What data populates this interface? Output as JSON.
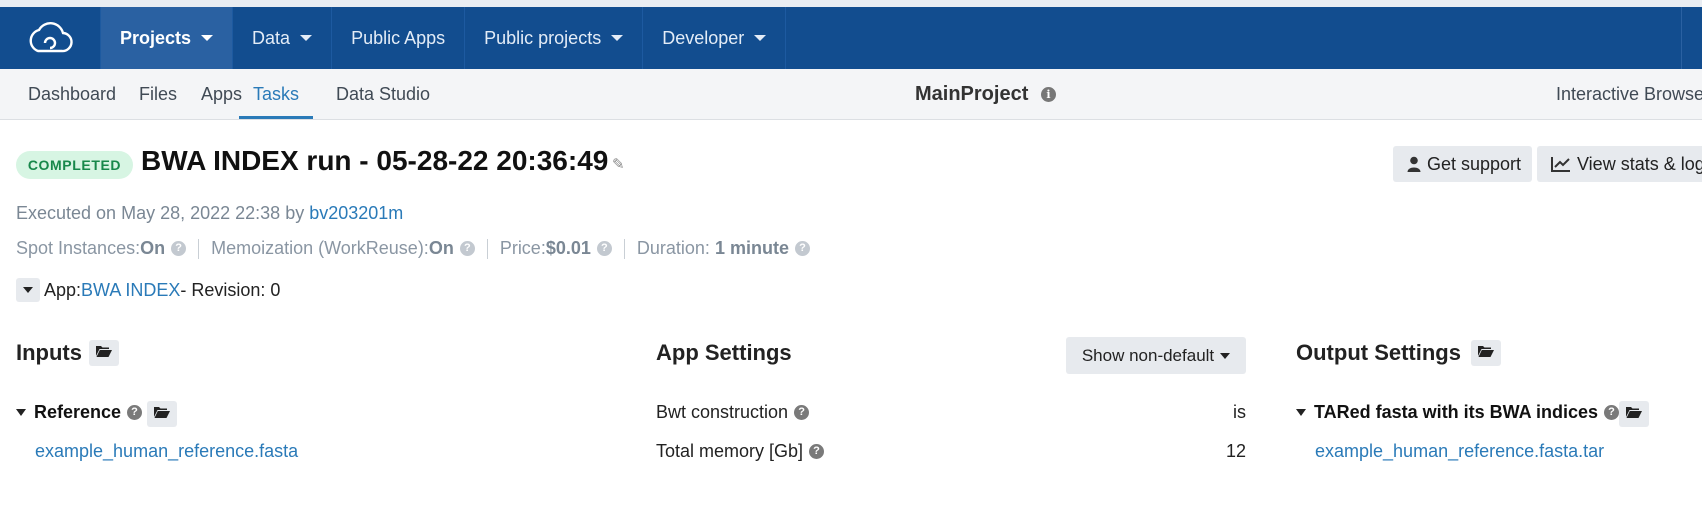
{
  "navbar": {
    "logo_icon": "cloud-logo-icon",
    "items": [
      {
        "label": "Projects",
        "dropdown": true,
        "active": true
      },
      {
        "label": "Data",
        "dropdown": true
      },
      {
        "label": "Public Apps",
        "dropdown": false
      },
      {
        "label": "Public projects",
        "dropdown": true
      },
      {
        "label": "Developer",
        "dropdown": true
      }
    ],
    "color": "#124d8f"
  },
  "subnav": {
    "tabs": [
      "Dashboard",
      "Files",
      "Apps",
      "Tasks",
      "Data Studio"
    ],
    "active_tab": "Tasks",
    "project_title": "MainProject",
    "interactive_label": "Interactive Browser"
  },
  "task": {
    "status": "COMPLETED",
    "title": "BWA INDEX run - 05-28-22 20:36:49",
    "executed_prefix": "Executed on May 28, 2022 22:38 by ",
    "executed_user": "bv203201m",
    "spot_label": "Spot Instances: ",
    "spot_value": "On",
    "memo_label": "Memoization (WorkReuse): ",
    "memo_value": "On",
    "price_label": "Price: ",
    "price_value": "$0.01",
    "duration_label": "Duration: ",
    "duration_value": "1 minute",
    "app_label": "App: ",
    "app_name": "BWA INDEX",
    "revision": " - Revision: 0"
  },
  "actions": {
    "support_label": "Get support",
    "stats_label": "View stats & logs"
  },
  "inputs": {
    "heading": "Inputs",
    "reference_label": "Reference",
    "reference_file": "example_human_reference.fasta"
  },
  "app_settings": {
    "heading": "App Settings",
    "filter_label": "Show non-default",
    "rows": [
      {
        "label": "Bwt construction",
        "value": "is"
      },
      {
        "label": "Total memory [Gb]",
        "value": "12"
      }
    ]
  },
  "output_settings": {
    "heading": "Output Settings",
    "output_label": "TARed fasta with its BWA indices",
    "output_file": "example_human_reference.fasta.tar"
  },
  "colors": {
    "accent": "#2a7ab8",
    "badge_bg": "#d7f5e3",
    "badge_text": "#18884b"
  }
}
